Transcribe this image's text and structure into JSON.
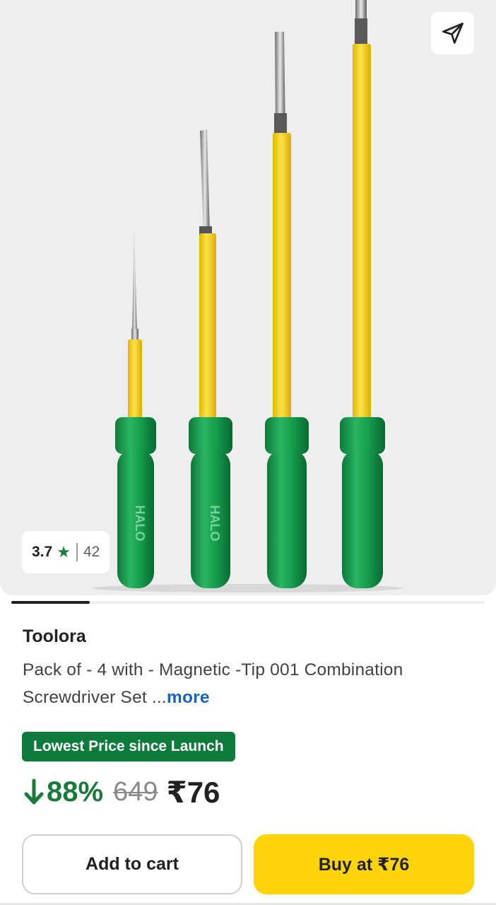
{
  "product": {
    "image_alt": "Four screwdrivers with yellow shafts and green handles",
    "handle_text": "HALO",
    "brand": "Toolora",
    "title": "Pack of - 4 with - Magnetic -Tip 001 Combination Screwdriver Set ...",
    "more_label": "more"
  },
  "rating": {
    "value": "3.7",
    "star_icon": "star-icon",
    "count": "42"
  },
  "carousel": {
    "position_fraction": 0.166
  },
  "offer": {
    "badge": "Lowest Price since Launch",
    "discount": "88%",
    "mrp": "649",
    "price": "₹76"
  },
  "actions": {
    "add_to_cart": "Add to cart",
    "buy_now": "Buy at ₹76"
  },
  "icons": {
    "share": "send-share-icon",
    "discount_arrow": "arrow-down-icon"
  },
  "colors": {
    "accent_green": "#1b7a3b",
    "badge_green": "#0e7a3c",
    "buy_yellow": "#ffd40a",
    "link_blue": "#1565c0"
  }
}
